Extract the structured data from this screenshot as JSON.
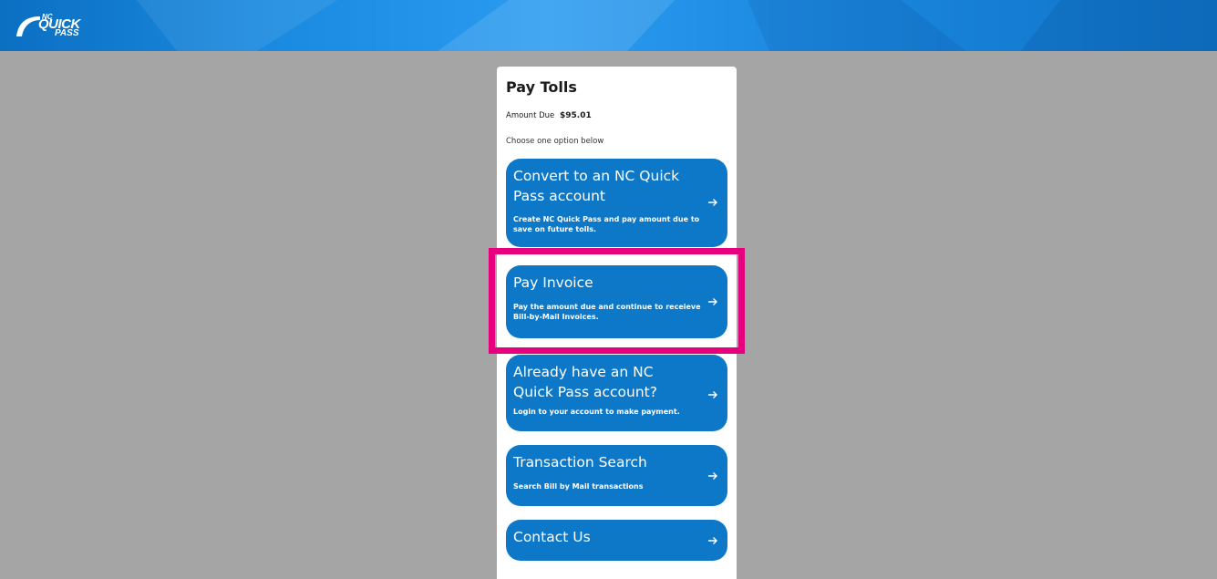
{
  "header": {
    "logo": {
      "nc": "NC",
      "quick": "QUICK",
      "pass": "PASS"
    }
  },
  "panel": {
    "title": "Pay Tolls",
    "amount_label": "Amount Due",
    "amount_value": "$95.01",
    "choose_text": "Choose one option below"
  },
  "options": [
    {
      "title": "Convert to an NC Quick Pass account",
      "description": "Create NC Quick Pass and pay amount due to save on future tolls.",
      "icon": "arrow-right-icon"
    },
    {
      "title": "Pay Invoice",
      "description": "Pay the amount due and continue to receieve Bill-by-Mail Invoices.",
      "icon": "arrow-right-icon"
    },
    {
      "title": "Already have an NC Quick Pass account?",
      "description": "Login to your account to make payment.",
      "icon": "arrow-right-icon"
    },
    {
      "title": "Transaction Search",
      "description": "Search Bill by Mail transactions",
      "icon": "arrow-right-icon"
    },
    {
      "title": "Contact Us",
      "description": "",
      "icon": "arrow-right-icon"
    }
  ],
  "colors": {
    "background": "#a5a5a5",
    "header_blue": "#1a8ae0",
    "card_blue": "#0d78c8",
    "highlight": "#e6007e"
  }
}
